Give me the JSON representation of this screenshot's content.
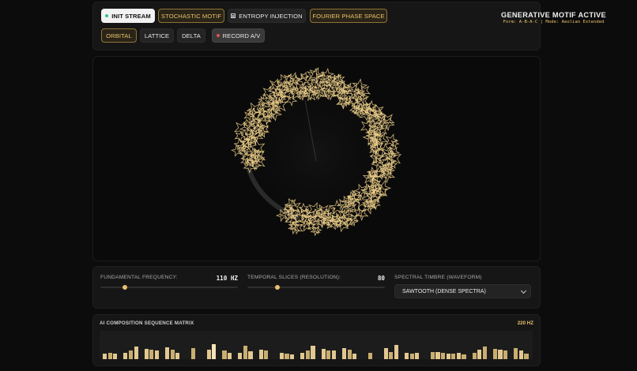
{
  "toolbar": {
    "init_stream": "INIT STREAM",
    "stochastic_motif": "STOCHASTIC MOTIF",
    "entropy_injection": "ENTROPY INJECTION",
    "fourier_phase_space": "FOURIER PHASE SPACE",
    "orbital": "ORBITAL",
    "lattice": "LATTICE",
    "delta": "DELTA",
    "record": "RECORD A/V"
  },
  "status": {
    "title": "GENERATIVE MOTIF ACTIVE",
    "subtitle": "Form: A-B-A-C | Mode: Aeolian Extended"
  },
  "controls": {
    "frequency_label": "FUNDAMENTAL FREQUENCY:",
    "frequency_value": "110 HZ",
    "frequency_level": 0.18,
    "slices_label": "TEMPORAL SLICES (RESOLUTION):",
    "slices_value": "80",
    "slices_level": 0.22,
    "timbre_label": "SPECTRAL TIMBRE (WAVEFORM)",
    "timbre_selected": "SAWTOOTH (DENSE SPECTRA)"
  },
  "matrix": {
    "title": "AI COMPOSITION SEQUENCE MATRIX",
    "frequency": "220 HZ",
    "steps": [
      0.35,
      0.38,
      0.35,
      0,
      0.4,
      0.55,
      0.8,
      0,
      0.65,
      0.6,
      0.55,
      0,
      0.75,
      0.6,
      0.4,
      0,
      0,
      0.7,
      0,
      0,
      0.6,
      0.95,
      0,
      0.55,
      0.4,
      0,
      0.4,
      0.85,
      0.5,
      0,
      0.6,
      0.55,
      0,
      0,
      0.4,
      0.35,
      0.3,
      0,
      0.4,
      0.55,
      0.85,
      0,
      0.65,
      0.55,
      0.55,
      0,
      0.7,
      0.6,
      0.35,
      0,
      0,
      0.4,
      0,
      0,
      0.7,
      0.45,
      0.9,
      0,
      0.4,
      0.35,
      0.4,
      0,
      0,
      0.45,
      0.45,
      0.4,
      0.35,
      0.35,
      0.38,
      0.3,
      0,
      0.42,
      0.6,
      0.8,
      0,
      0.65,
      0.6,
      0.55,
      0,
      0.7,
      0.55,
      0.35
    ],
    "colors": {
      "bar": "#e2c890",
      "bar_dim": "#c9ae70",
      "highlight": "#f6e2b8"
    }
  },
  "visual": {
    "accent": "#e8c26a",
    "stroke": "#efd08a"
  }
}
